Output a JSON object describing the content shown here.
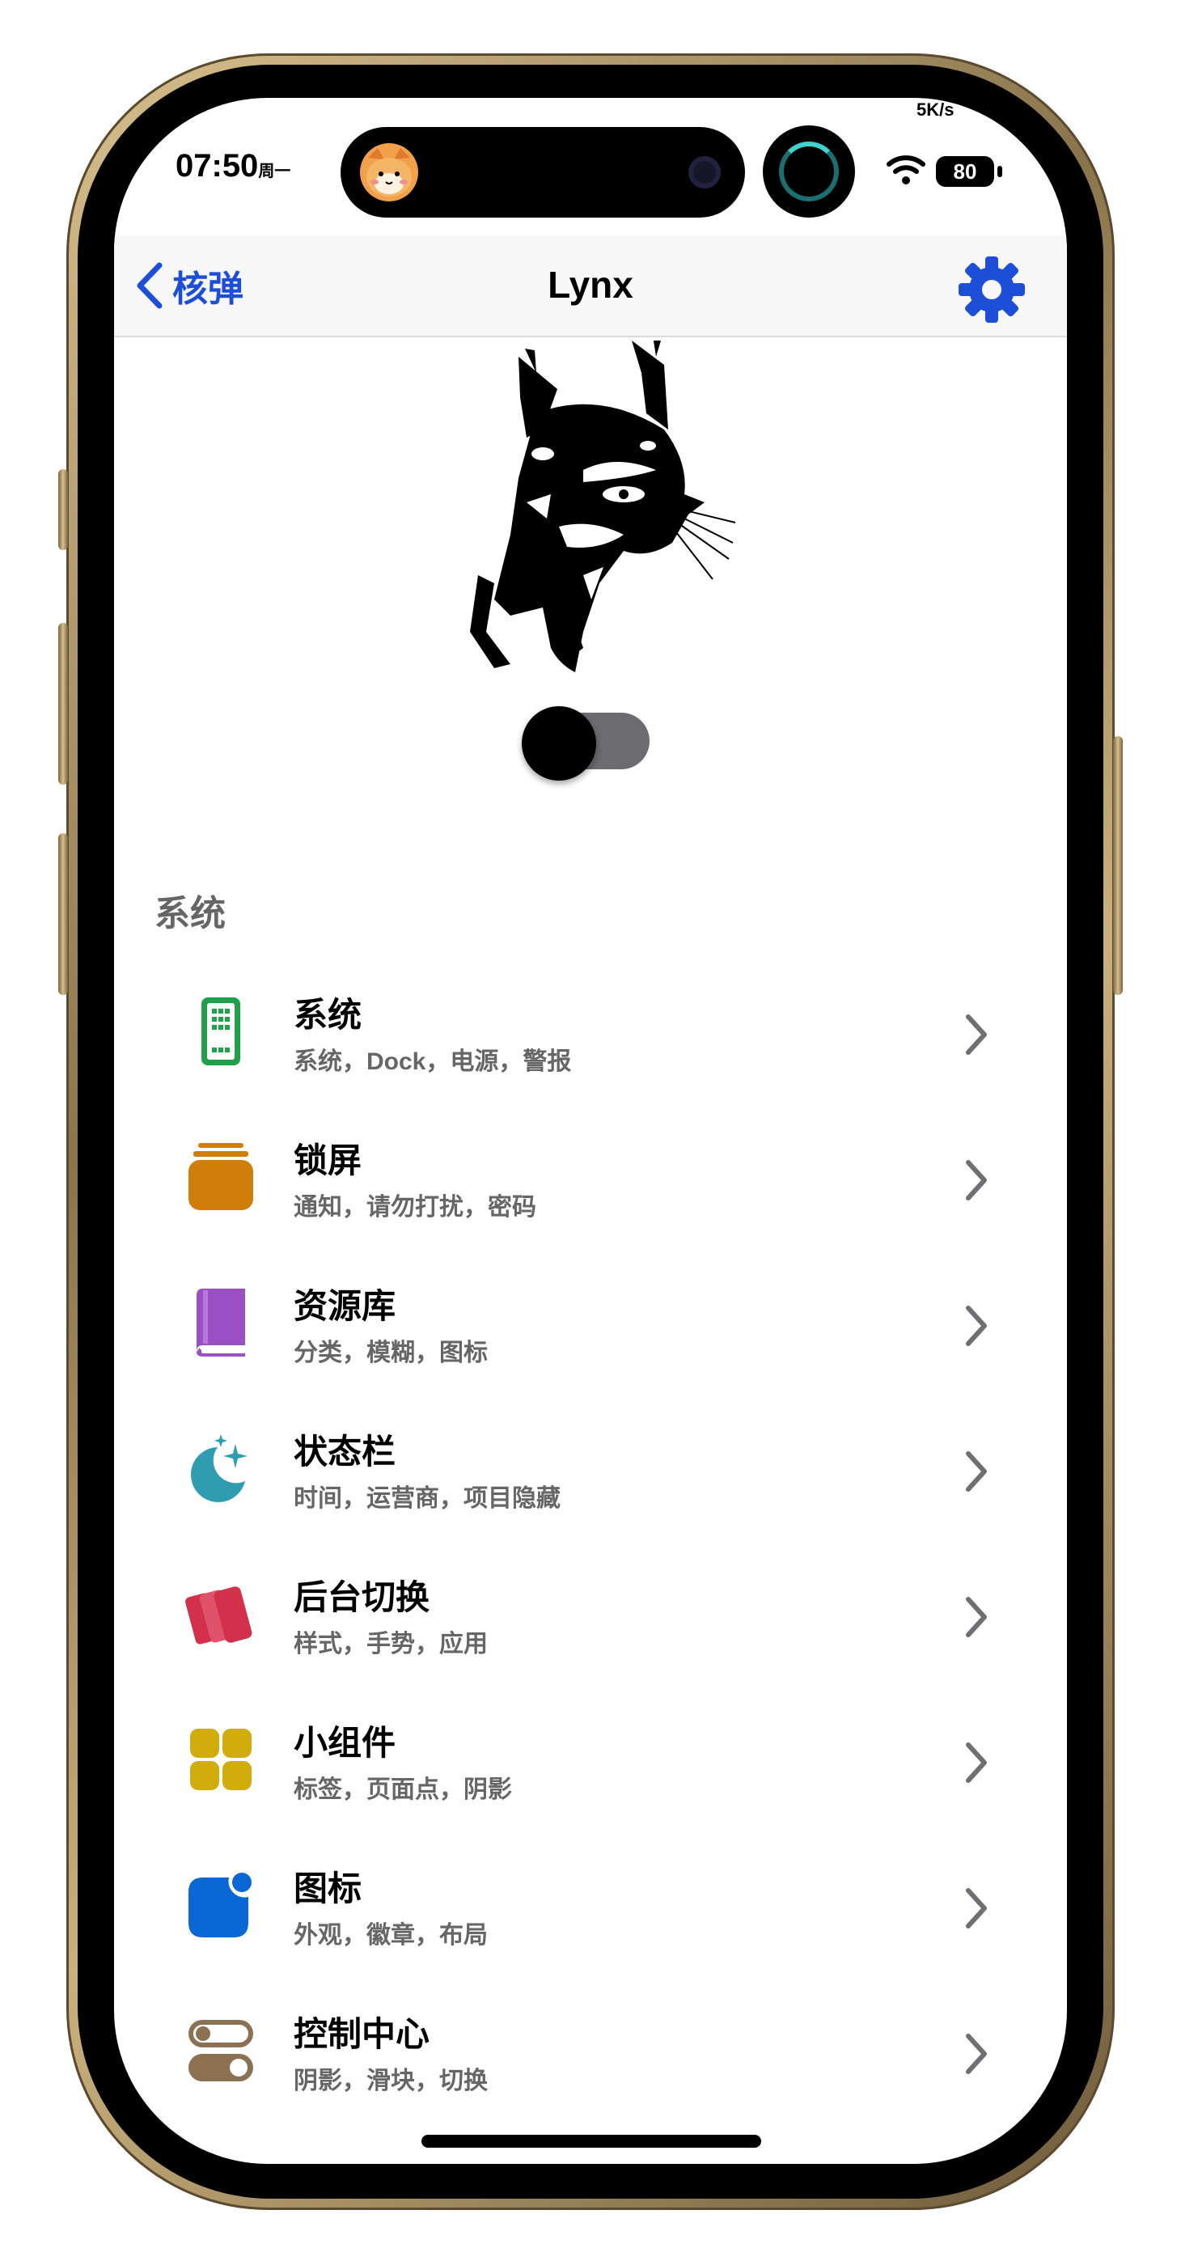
{
  "status_bar": {
    "time": "07:50",
    "weekday": "周一",
    "net_speed": "5K/s",
    "battery": "80"
  },
  "nav": {
    "back_label": "核弹",
    "title": "Lynx"
  },
  "toggle": {
    "on": false
  },
  "section_title": "系统",
  "items": [
    {
      "title": "系统",
      "subtitle": "系统，Dock，电源，警报",
      "icon": "phone-icon",
      "color": "#21a04a"
    },
    {
      "title": "锁屏",
      "subtitle": "通知，请勿打扰，密码",
      "icon": "stack-icon",
      "color": "#d07e0a"
    },
    {
      "title": "资源库",
      "subtitle": "分类，模糊，图标",
      "icon": "book-icon",
      "color": "#9a4fc4"
    },
    {
      "title": "状态栏",
      "subtitle": "时间，运营商，项目隐藏",
      "icon": "moon-stars-icon",
      "color": "#2f9cb0"
    },
    {
      "title": "后台切换",
      "subtitle": "样式，手势，应用",
      "icon": "cards-icon",
      "color": "#d3304c"
    },
    {
      "title": "小组件",
      "subtitle": "标签，页面点，阴影",
      "icon": "grid-icon",
      "color": "#d2ac0a"
    },
    {
      "title": "图标",
      "subtitle": "外观，徽章，布局",
      "icon": "app-badge-icon",
      "color": "#0a67d6"
    },
    {
      "title": "控制中心",
      "subtitle": "阴影，滑块，切换",
      "icon": "switches-icon",
      "color": "#8b7152"
    }
  ],
  "colors": {
    "accent": "#1d4ed8",
    "chevron": "#8e8e93",
    "secondary_text": "#666666"
  }
}
